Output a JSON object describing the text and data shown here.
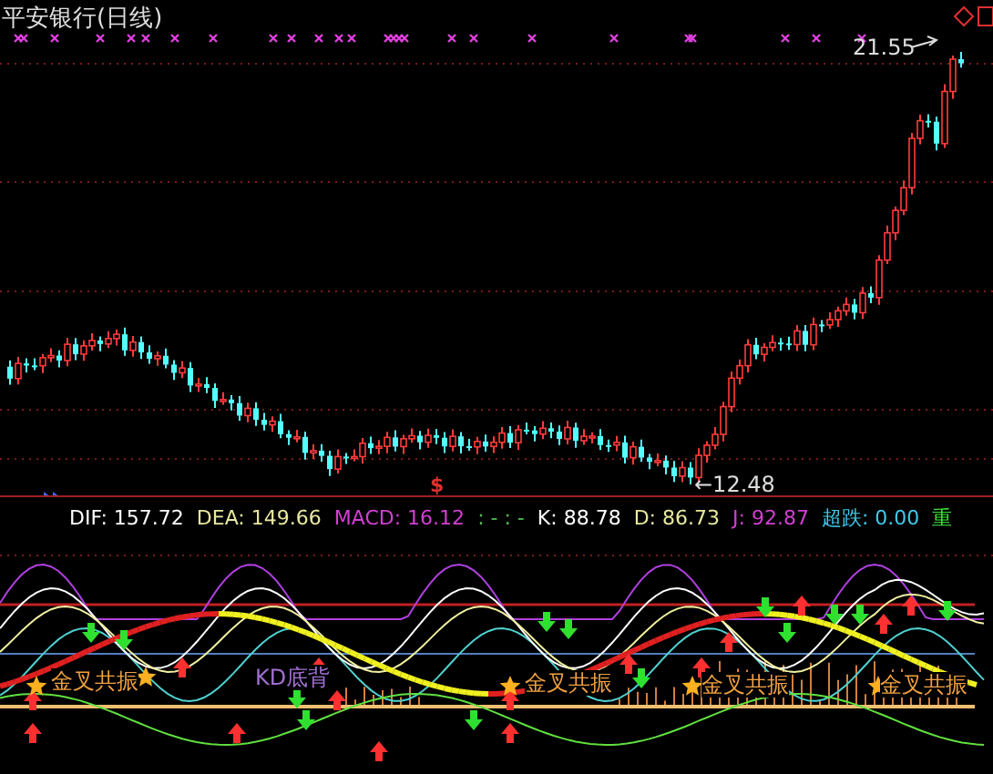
{
  "chart": {
    "title": "平安银行(日线)",
    "high_label": "21.55",
    "low_label": "←12.48",
    "signal_mark": "$"
  },
  "indicator_bar": [
    {
      "label": "DIF:",
      "value": "157.72",
      "color": "#ffffff"
    },
    {
      "label": "DEA:",
      "value": "149.66",
      "color": "#e8e8a0"
    },
    {
      "label": "MACD:",
      "value": "16.12",
      "color": "#d040d0"
    },
    {
      "label": ": - : -",
      "color": "#50c050"
    },
    {
      "label": "K:",
      "value": "88.78",
      "color": "#ffffff"
    },
    {
      "label": "D:",
      "value": "86.73",
      "color": "#e8e8a0"
    },
    {
      "label": "J:",
      "value": "92.87",
      "color": "#d040d0"
    },
    {
      "label": "超跌:",
      "value": "0.00",
      "color": "#40c8e8"
    },
    {
      "label": "重",
      "color": "#40e040"
    }
  ],
  "signals": [
    {
      "text": "金叉共振",
      "kind": "golden"
    },
    {
      "text": "KD底背",
      "kind": "divergence"
    },
    {
      "text": "金叉共振",
      "kind": "golden"
    },
    {
      "text": "金叉共振",
      "kind": "golden"
    },
    {
      "text": "金叉共振",
      "kind": "golden"
    }
  ]
}
